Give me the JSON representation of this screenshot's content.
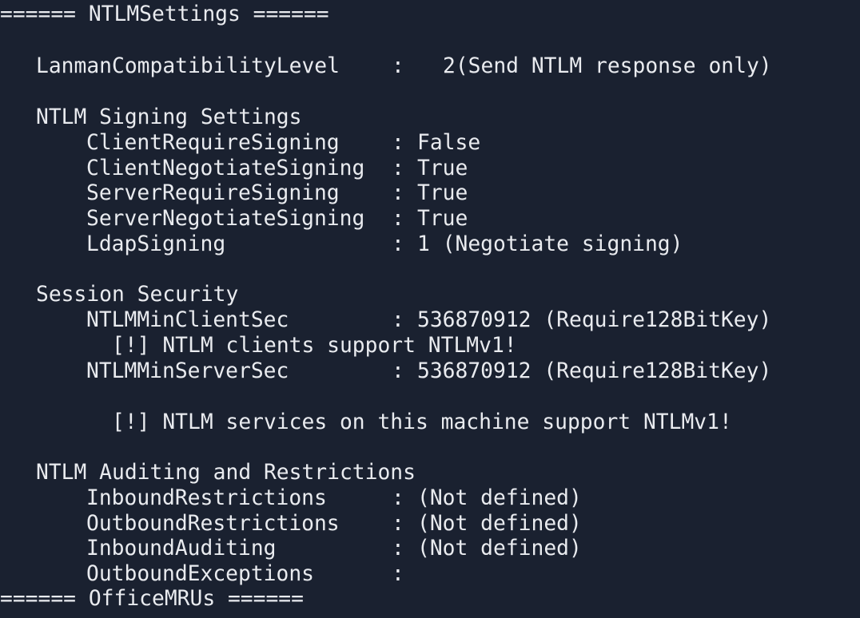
{
  "terminal": {
    "background": "#1a2130",
    "text_color": "#e9ebef",
    "section_ntlm_header": "====== NTLMSettings ======",
    "lanman": {
      "key": "LanmanCompatibilityLevel",
      "sep": ":",
      "value": "2(Send NTLM response only)"
    },
    "signing": {
      "heading": "NTLM Signing Settings",
      "rows": [
        {
          "key": "ClientRequireSigning",
          "sep": ":",
          "value": "False"
        },
        {
          "key": "ClientNegotiateSigning",
          "sep": ":",
          "value": "True"
        },
        {
          "key": "ServerRequireSigning",
          "sep": ":",
          "value": "True"
        },
        {
          "key": "ServerNegotiateSigning",
          "sep": ":",
          "value": "True"
        },
        {
          "key": "LdapSigning",
          "sep": ":",
          "value": "1 (Negotiate signing)"
        }
      ]
    },
    "session": {
      "heading": "Session Security",
      "min_client": {
        "key": "NTLMMinClientSec",
        "sep": ":",
        "value": "536870912 (Require128BitKey)"
      },
      "client_warning": "[!] NTLM clients support NTLMv1!",
      "min_server": {
        "key": "NTLMMinServerSec",
        "sep": ":",
        "value": "536870912 (Require128BitKey)"
      },
      "server_warning": "[!] NTLM services on this machine support NTLMv1!"
    },
    "auditing": {
      "heading": "NTLM Auditing and Restrictions",
      "rows": [
        {
          "key": "InboundRestrictions",
          "sep": ":",
          "value": "(Not defined)"
        },
        {
          "key": "OutboundRestrictions",
          "sep": ":",
          "value": "(Not defined)"
        },
        {
          "key": "InboundAuditing",
          "sep": ":",
          "value": "(Not defined)"
        },
        {
          "key": "OutboundExceptions",
          "sep": ":",
          "value": ""
        }
      ]
    },
    "section_office_header": "====== OfficeMRUs ======"
  }
}
